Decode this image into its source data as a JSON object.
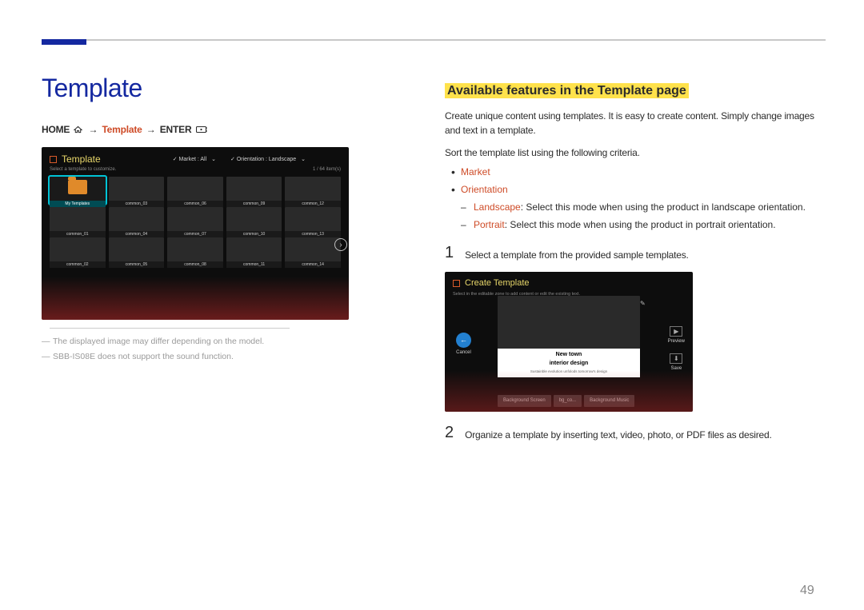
{
  "page_number": "49",
  "main_title": "Template",
  "breadcrumb": {
    "home": "HOME",
    "template": "Template",
    "enter": "ENTER",
    "arrow": "→"
  },
  "template_screenshot": {
    "title": "Template",
    "subtitle": "Select a template to customize.",
    "market_label": "Market : All",
    "orient_label": "Orientation : Landscape",
    "count": "1 / 64 item(s)",
    "cells": [
      {
        "label": "My Templates",
        "selected": true
      },
      {
        "label": "common_03"
      },
      {
        "label": "common_06"
      },
      {
        "label": "common_09"
      },
      {
        "label": "common_12"
      },
      {
        "label": "common_01"
      },
      {
        "label": "common_04"
      },
      {
        "label": "common_07"
      },
      {
        "label": "common_10"
      },
      {
        "label": "common_13"
      },
      {
        "label": "common_02"
      },
      {
        "label": "common_05"
      },
      {
        "label": "common_08"
      },
      {
        "label": "common_11"
      },
      {
        "label": "common_14"
      }
    ]
  },
  "footnotes": [
    "The displayed image may differ depending on the model.",
    "SBB-IS08E does not support the sound function."
  ],
  "section": {
    "title": "Available features in the Template page",
    "p1": "Create unique content using templates. It is easy to create content. Simply change images and text in a template.",
    "p2": "Sort the template list using the following criteria.",
    "bullets": {
      "market": "Market",
      "orientation": "Orientation",
      "landscape_label": "Landscape",
      "landscape_desc": ": Select this mode when using the product in landscape orientation.",
      "portrait_label": "Portrait",
      "portrait_desc": ": Select this mode when using the product in portrait orientation."
    },
    "step1": {
      "num": "1",
      "text": "Select a template from the provided sample templates."
    },
    "step2": {
      "num": "2",
      "text": "Organize a template by inserting text, video, photo, or PDF files as desired."
    }
  },
  "create_screenshot": {
    "title": "Create Template",
    "subtitle": "Select in the editable zone to add content or edit the existing text.",
    "cancel": "Cancel",
    "preview": "Preview",
    "save": "Save",
    "line1": "New town",
    "line2": "interior design",
    "line3": "Sustainble evolution unfolods tomorrow's design",
    "tabs": [
      "Background Screen",
      "bg_co...",
      "Background Music"
    ]
  }
}
